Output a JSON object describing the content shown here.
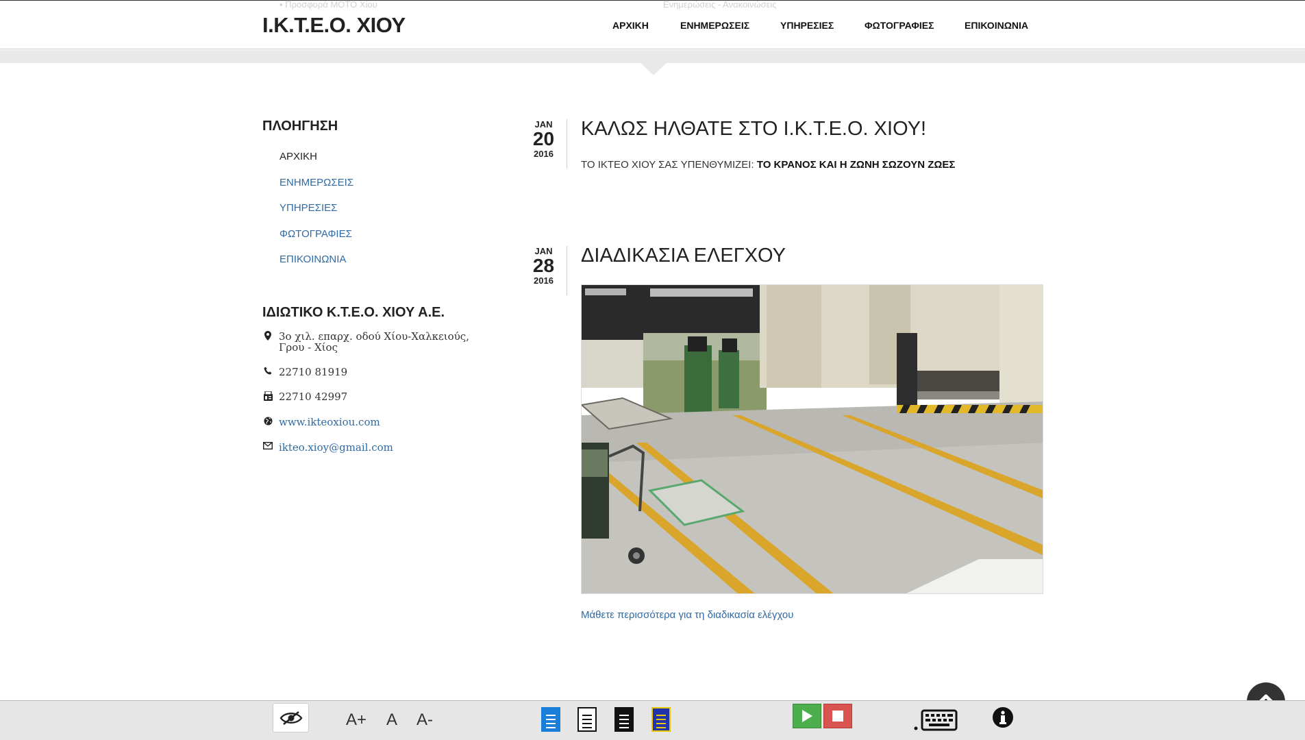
{
  "header": {
    "title": "Ι.Κ.Τ.Ε.Ο. ΧΙΟΥ",
    "ghost_left": "▪ Προσφορά ΜΟΤΟ Χίου",
    "ghost_right": "Ενημερώσεις - Ανακοινώσεις",
    "nav": [
      "ΑΡΧΙΚΗ",
      "ΕΝΗΜΕΡΩΣΕΙΣ",
      "ΥΠΗΡΕΣΙΕΣ",
      "ΦΩΤΟΓΡΑΦΙΕΣ",
      "ΕΠΙΚΟΙΝΩΝΙΑ"
    ]
  },
  "sidebar": {
    "nav_heading": "ΠΛΟΗΓΗΣΗ",
    "nav_items": [
      "ΑΡΧΙΚΗ",
      "ΕΝΗΜΕΡΩΣΕΙΣ",
      "ΥΠΗΡΕΣΙΕΣ",
      "ΦΩΤΟΓΡΑΦΙΕΣ",
      "ΕΠΙΚΟΙΝΩΝΙΑ"
    ],
    "company_heading": "ΙΔΙΩΤΙΚΟ Κ.Τ.Ε.Ο. ΧΙΟΥ Α.Ε.",
    "address": "3ο χιλ. επαρχ. οδού Χίου-Χαλκειούς, Γρου - Χίος",
    "phone": "22710 81919",
    "fax": "22710 42997",
    "website": "www.ikteoxiou.com",
    "email": "ikteo.xioy@gmail.com"
  },
  "posts": [
    {
      "month": "JAN",
      "day": "20",
      "year": "2016",
      "title": "ΚΑΛΩΣ ΗΛΘΑΤΕ ΣΤΟ Ι.Κ.Τ.Ε.Ο. ΧΙΟΥ!",
      "body_prefix": "ΤΟ ΙΚΤΕΟ ΧΙΟΥ ΣΑΣ ΥΠΕΝΘΥΜΙΖΕΙ: ",
      "body_bold": "ΤΟ ΚΡΑΝΟΣ ΚΑΙ Η ΖΩΝΗ ΣΩΖΟΥΝ ΖΩΕΣ"
    },
    {
      "month": "JAN",
      "day": "28",
      "year": "2016",
      "title": "ΔΙΑΔΙΚΑΣΙΑ ΕΛΕΓΧΟΥ",
      "more_link": "Μάθετε περισσότερα για τη διαδικασία ελέγχου"
    }
  ],
  "toolbar": {
    "font_increase": "A+",
    "font_normal": "A",
    "font_decrease": "A-"
  },
  "colors": {
    "link": "#2f6aa4",
    "play": "#4cae4c",
    "stop": "#d9534f"
  }
}
